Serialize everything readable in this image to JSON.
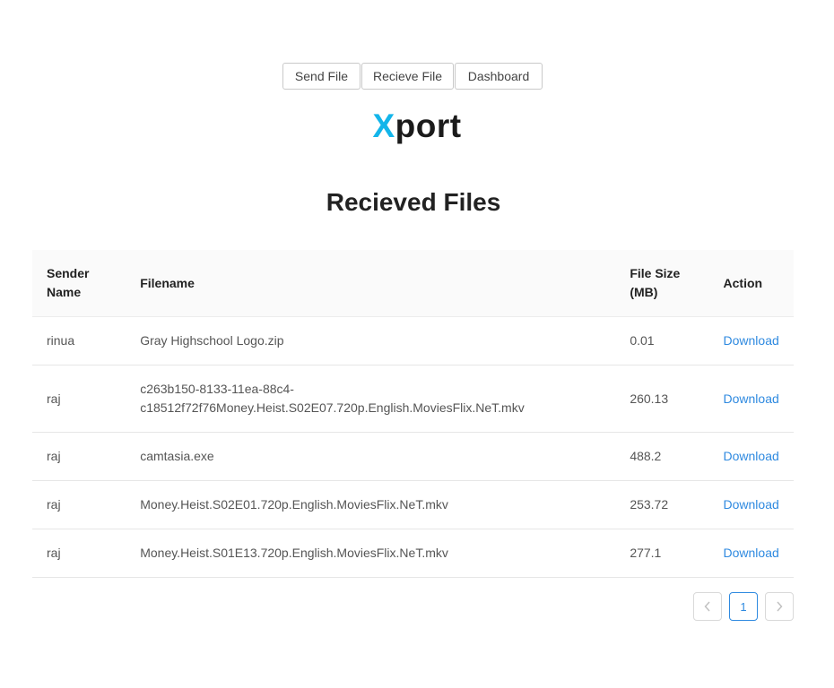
{
  "nav": {
    "send_label": "Send File",
    "recieve_label": "Recieve File",
    "dashboard_label": "Dashboard"
  },
  "logo": {
    "accent": "X",
    "rest": "port",
    "accent_color": "#13b5ea"
  },
  "heading": "Recieved Files",
  "table": {
    "headers": {
      "sender_line1": "Sender",
      "sender_line2": "Name",
      "filename": "Filename",
      "size_line1": "File Size",
      "size_line2": "(MB)",
      "action": "Action"
    },
    "rows": [
      {
        "sender": "rinua",
        "filename_line1": "Gray Highschool Logo.zip",
        "filename_line2": "",
        "size": "0.01",
        "action": "Download"
      },
      {
        "sender": "raj",
        "filename_line1": "c263b150-8133-11ea-88c4-",
        "filename_line2": "c18512f72f76Money.Heist.S02E07.720p.English.MoviesFlix.NeT.mkv",
        "size": "260.13",
        "action": "Download"
      },
      {
        "sender": "raj",
        "filename_line1": "camtasia.exe",
        "filename_line2": "",
        "size": "488.2",
        "action": "Download"
      },
      {
        "sender": "raj",
        "filename_line1": "Money.Heist.S02E01.720p.English.MoviesFlix.NeT.mkv",
        "filename_line2": "",
        "size": "253.72",
        "action": "Download"
      },
      {
        "sender": "raj",
        "filename_line1": "Money.Heist.S01E13.720p.English.MoviesFlix.NeT.mkv",
        "filename_line2": "",
        "size": "277.1",
        "action": "Download"
      }
    ]
  },
  "pagination": {
    "current_page": "1",
    "prev_icon": "chevron-left-icon",
    "next_icon": "chevron-right-icon"
  },
  "colors": {
    "link": "#2f8ae0",
    "header_bg": "#fafafa"
  }
}
